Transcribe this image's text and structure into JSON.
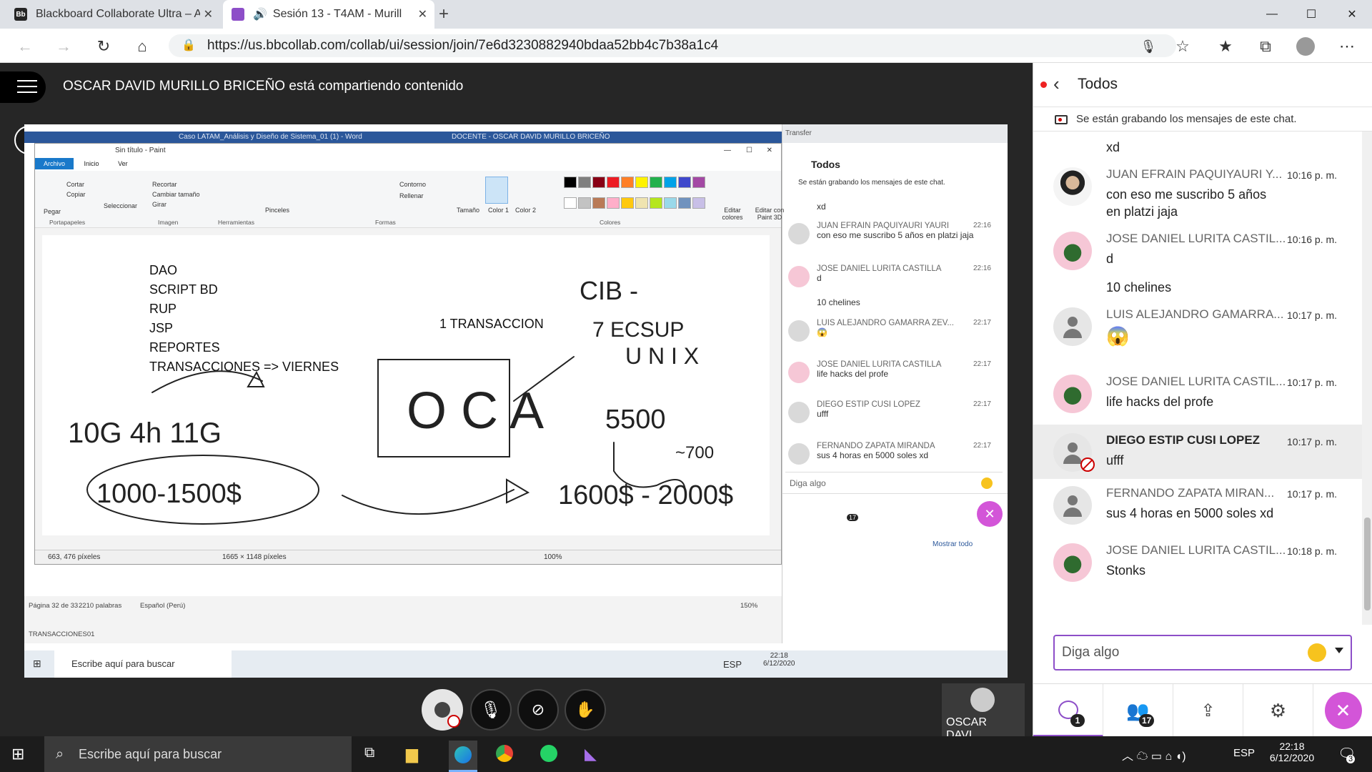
{
  "browser": {
    "tabs": [
      {
        "title": "Blackboard Collaborate Ultra – A",
        "favicon": "Bb"
      },
      {
        "title": "Sesión 13 - T4AM - Murillo",
        "active": true
      }
    ],
    "url": "https://us.bbcollab.com/collab/ui/session/join/7e6d3230882940bdaa52bb4c7b38a1c4"
  },
  "collab": {
    "share_message": "OSCAR DAVID MURILLO BRICEÑO está compartiendo contenido",
    "presenter_tile": "OSCAR DAVI..."
  },
  "shared": {
    "word_title": "Caso LATAM_Análisis y Diseño de Sistema_01 (1)  -  Word",
    "word_user": "DOCENTE - OSCAR DAVID MURILLO BRICEÑO",
    "paint_title": "Sin título - Paint",
    "paint_tabs": [
      "Archivo",
      "Inicio",
      "Ver"
    ],
    "ribbon_groups": [
      "Portapapeles",
      "Imagen",
      "Herramientas",
      "Formas",
      "Colores"
    ],
    "ribbon_labels": {
      "pegar": "Pegar",
      "cortar": "Cortar",
      "copiar": "Copiar",
      "seleccionar": "Seleccionar",
      "recortar": "Recortar",
      "cambiar": "Cambiar tamaño",
      "girar": "Girar",
      "pinceles": "Pinceles",
      "contorno": "Contorno",
      "rellenar": "Rellenar",
      "tamano": "Tamaño",
      "color1": "Color 1",
      "color2": "Color 2",
      "editar_colores": "Editar colores",
      "paint3d": "Editar con Paint 3D"
    },
    "palette": [
      "#000000",
      "#7f7f7f",
      "#880015",
      "#ed1c24",
      "#ff7f27",
      "#fff200",
      "#22b14c",
      "#00a2e8",
      "#3f48cc",
      "#a349a4",
      "#ffffff",
      "#c3c3c3",
      "#b97a57",
      "#ffaec9",
      "#ffc90e",
      "#efe4b0",
      "#b5e61d",
      "#99d9ea",
      "#7092be",
      "#c8bfe7"
    ],
    "canvas_text": {
      "list": [
        "DAO",
        "SCRIPT BD",
        "RUP",
        "JSP",
        "REPORTES",
        "TRANSACCIONES => VIERNES"
      ],
      "transaccion": "1 TRANSACCION"
    },
    "paint_status": {
      "cursor": "663, 476 píxeles",
      "size": "1665 × 1148 píxeles",
      "zoom": "100%"
    },
    "word_status": {
      "page": "Página 32 de 33",
      "words": "2210 palabras",
      "lang": "Español (Perú)",
      "zoom": "150%"
    },
    "word_doc_tab": "TRANSACCIONES01",
    "inner_chrome_tab": "Transfer",
    "inner_chat_title": "Todos",
    "inner_rec_note": "Se están grabando los mensajes de este chat.",
    "inner_messages": [
      {
        "text": "xd"
      },
      {
        "name": "JUAN EFRAIN PAQUIYAURI YAURI",
        "time": "22:16",
        "text": "con eso me suscribo 5 años en platzi jaja"
      },
      {
        "name": "JOSE DANIEL LURITA CASTILLA",
        "time": "22:16",
        "text": "d"
      },
      {
        "text": "10 chelines"
      },
      {
        "name": "LUIS ALEJANDRO GAMARRA ZEV...",
        "time": "22:17",
        "text": "😱"
      },
      {
        "name": "JOSE DANIEL LURITA CASTILLA",
        "time": "22:17",
        "text": "life hacks del profe"
      },
      {
        "name": "DIEGO ESTIP CUSI LOPEZ",
        "time": "22:17",
        "text": "ufff"
      },
      {
        "name": "FERNANDO ZAPATA MIRANDA",
        "time": "22:17",
        "text": "sus 4 horas en 5000 soles xd"
      }
    ],
    "inner_input": "Diga algo",
    "inner_show_all": "Mostrar todo",
    "inner_taskbar_search": "Escribe aquí para buscar",
    "inner_clock": {
      "time": "22:18",
      "date": "6/12/2020",
      "lang": "ESP"
    },
    "inner_badge": "17"
  },
  "chat": {
    "title": "Todos",
    "rec_note": "Se están grabando los mensajes de este chat.",
    "messages": [
      {
        "text": "xd"
      },
      {
        "name": "JUAN EFRAIN PAQUIYAURI Y...",
        "time": "10:16 p. m.",
        "text": "con eso me suscribo 5 años en platzi jaja",
        "avatar": "photo"
      },
      {
        "name": "JOSE DANIEL LURITA CASTIL...",
        "time": "10:16 p. m.",
        "text": "d",
        "avatar": "green"
      },
      {
        "text": "10 chelines"
      },
      {
        "name": "LUIS ALEJANDRO GAMARRA...",
        "time": "10:17 p. m.",
        "text": "😱",
        "avatar": "person"
      },
      {
        "name": "JOSE DANIEL LURITA CASTIL...",
        "time": "10:17 p. m.",
        "text": "life hacks del profe",
        "avatar": "green"
      },
      {
        "name": "DIEGO ESTIP CUSI LOPEZ",
        "time": "10:17 p. m.",
        "text": "ufff",
        "avatar": "person",
        "highlight": true
      },
      {
        "name": "FERNANDO ZAPATA MIRAN...",
        "time": "10:17 p. m.",
        "text": "sus 4 horas en 5000 soles xd",
        "avatar": "person"
      },
      {
        "name": "JOSE DANIEL LURITA CASTIL...",
        "time": "10:18 p. m.",
        "text": "Stonks",
        "avatar": "green"
      }
    ],
    "input_placeholder": "Diga algo",
    "footer": {
      "chat_badge": "1",
      "attendees_badge": "17"
    }
  },
  "taskbar": {
    "search": "Escribe aquí para buscar",
    "lang": "ESP",
    "time": "22:18",
    "date": "6/12/2020",
    "notifications": "3"
  }
}
